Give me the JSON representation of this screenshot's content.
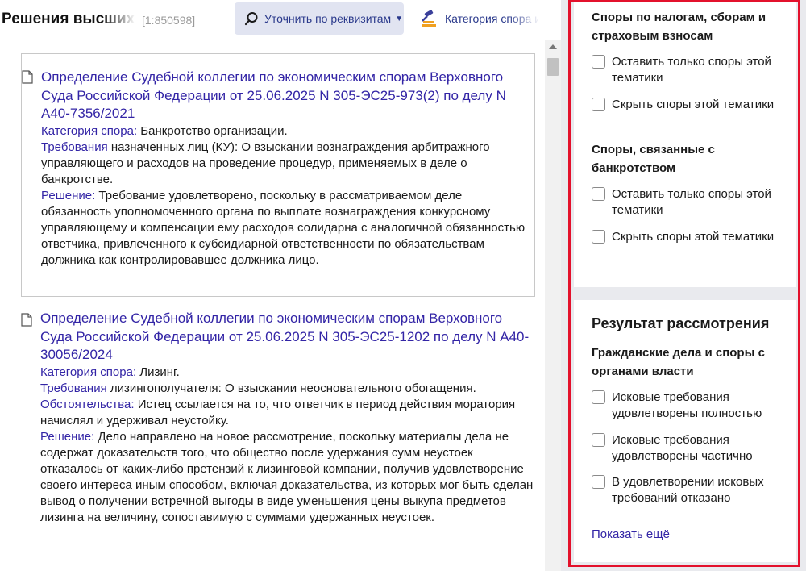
{
  "header": {
    "title": "Решения высших",
    "count": "[1:850598]",
    "refine_label": "Уточнить по реквизитам",
    "category_label": "Категория спора и"
  },
  "results": [
    {
      "title": "Определение Судебной коллегии по экономическим спорам Верховного Суда Российской Федерации от 25.06.2025 N 305-ЭС25-973(2) по делу N А40-7356/2021",
      "category_label": "Категория спора:",
      "category_value": " Банкротство организации.",
      "requirements_label": "Требования",
      "requirements_text": " назначенных лиц (КУ): О взыскании вознаграждения арбитражного управляющего и расходов на проведение процедур, применяемых в деле о банкротстве.",
      "decision_label": "Решение:",
      "decision_text": " Требование удовлетворено, поскольку в рассматриваемом деле обязанность уполномоченного органа по выплате вознаграждения конкурсному управляющему и компенсации ему расходов солидарна с аналогичной обязанностью ответчика, привлеченного к субсидиарной ответственности по обязательствам должника как контролировавшее должника лицо."
    },
    {
      "title": "Определение Судебной коллегии по экономическим спорам Верховного Суда Российской Федерации от 25.06.2025 N 305-ЭС25-1202 по делу N А40-30056/2024",
      "category_label": "Категория спора:",
      "category_value": " Лизинг.",
      "requirements_label": "Требования",
      "requirements_text": " лизингополучателя: О взыскании неосновательного обогащения.",
      "circumstances_label": "Обстоятельства:",
      "circumstances_text": " Истец ссылается на то, что ответчик в период действия моратория начислял и удерживал неустойку.",
      "decision_label": "Решение:",
      "decision_text": " Дело направлено на новое рассмотрение, поскольку материалы дела не содержат доказательств того, что общество после удержания сумм неустоек отказалось от каких-либо претензий к лизинговой компании, получив удовлетворение своего интереса иным способом, включая доказательства, из которых мог быть сделан вывод о получении встречной выгоды в виде уменьшения цены выкупа предметов лизинга на величину, сопоставимую с суммами удержанных неустоек."
    }
  ],
  "filters": {
    "tax_group": {
      "title": "Споры по налогам, сборам и страховым взносам",
      "keep_label": "Оставить только споры этой тематики",
      "hide_label": "Скрыть споры этой тематики"
    },
    "bankruptcy_group": {
      "title": "Споры, связанные с банкротством",
      "keep_label": "Оставить только споры этой тематики",
      "hide_label": "Скрыть споры этой тематики"
    },
    "result_section": {
      "title": "Результат рассмотрения",
      "group_title": "Гражданские дела и споры с органами власти",
      "options": [
        "Исковые требования удовлетворены полностью",
        "Исковые требования удовлетворены частично",
        "В удовлетворении исковых требований отказано"
      ],
      "show_more": "Показать ещё"
    }
  },
  "colors": {
    "link": "#3325a6",
    "highlight_frame": "#e3112c",
    "refine_button_bg": "#e1e4f1",
    "panel_bg": "#e9eaee"
  },
  "icons": {
    "refine": "search-icon",
    "category": "gavel-icon",
    "document": "document-icon"
  }
}
